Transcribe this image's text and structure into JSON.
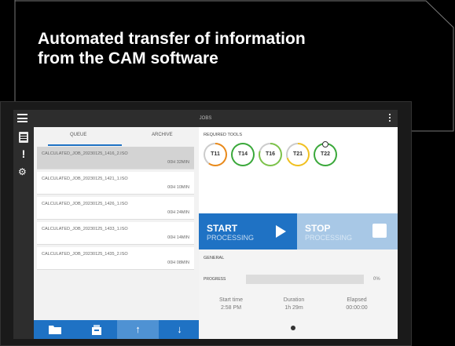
{
  "headline": {
    "line1": "Automated transfer of information",
    "line2": "from the CAM software"
  },
  "app": {
    "title": "JOBS",
    "icons": {
      "menu": "hamburger-menu-icon",
      "more": "vertical-dots-icon",
      "jobs": "document-list-icon",
      "alerts": "exclamation-icon",
      "settings": "gears-icon"
    }
  },
  "queue": {
    "tabs": [
      "QUEUE",
      "ARCHIVE"
    ],
    "active_tab": "QUEUE",
    "jobs": [
      {
        "name": "CALCULATED_JOB_20230125_1416_2.ISO",
        "duration": "00H 32MIN",
        "selected": true
      },
      {
        "name": "CALCULATED_JOB_20230125_1421_1.ISO",
        "duration": "00H 10MIN",
        "selected": false
      },
      {
        "name": "CALCULATED_JOB_20230125_1426_1.ISO",
        "duration": "00H 24MIN",
        "selected": false
      },
      {
        "name": "CALCULATED_JOB_20230125_1433_1.ISO",
        "duration": "00H 14MIN",
        "selected": false
      },
      {
        "name": "CALCULATED_JOB_20230125_1435_2.ISO",
        "duration": "00H 08MIN",
        "selected": false
      }
    ],
    "toolbar": {
      "folder": "folder-icon",
      "load": "tray-icon",
      "up": "↑",
      "down": "↓"
    }
  },
  "tools": {
    "label": "REQUIRED TOOLS",
    "items": [
      {
        "label": "T11",
        "ring": "#e8891a",
        "dot": false
      },
      {
        "label": "T14",
        "ring": "#3aa83a",
        "dot": false
      },
      {
        "label": "T16",
        "ring": "#7cc24a",
        "dot": false
      },
      {
        "label": "T21",
        "ring": "#f0c020",
        "dot": false
      },
      {
        "label": "T22",
        "ring": "#3aa83a",
        "dot": true
      }
    ]
  },
  "actions": {
    "start": {
      "title": "START",
      "subtitle": "PROCESSING"
    },
    "stop": {
      "title": "STOP",
      "subtitle": "PROCESSING"
    }
  },
  "general": {
    "label": "GENERAL",
    "progress_label": "PROGRESS",
    "progress_value": 0,
    "progress_text": "0%",
    "stats": [
      {
        "label": "Start time",
        "value": "2:58 PM"
      },
      {
        "label": "Duration",
        "value": "1h 29m"
      },
      {
        "label": "Elapsed",
        "value": "00:00:00"
      }
    ]
  },
  "colors": {
    "accent": "#1f72c4",
    "accent_light": "#a8c8e6"
  }
}
